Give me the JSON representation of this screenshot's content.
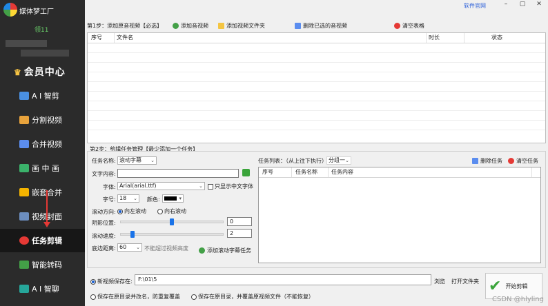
{
  "app": {
    "title": "媒体梦工厂",
    "user_code": "领11",
    "vip_label": "会员中心",
    "website_link": "软件官网",
    "window_controls": [
      "–",
      "▢",
      "✕"
    ]
  },
  "sidebar": {
    "items": [
      {
        "label": "A I 智剪",
        "icon": "ai-edit-icon",
        "color": "#4a90e2"
      },
      {
        "label": "分割视频",
        "icon": "split-video-icon",
        "color": "#e8a33c"
      },
      {
        "label": "合并视频",
        "icon": "merge-video-icon",
        "color": "#5b8def"
      },
      {
        "label": "画 中 画",
        "icon": "picture-in-picture-icon",
        "color": "#3bb26b"
      },
      {
        "label": "嵌套合并",
        "icon": "nested-merge-icon",
        "color": "#f4b400"
      },
      {
        "label": "视频封面",
        "icon": "video-cover-icon",
        "color": "#6c8ebf"
      },
      {
        "label": "任务剪辑",
        "icon": "task-edit-icon",
        "color": "#e53935"
      },
      {
        "label": "智能转码",
        "icon": "smart-transcode-icon",
        "color": "#43a047"
      },
      {
        "label": "A I 智聊",
        "icon": "ai-chat-icon",
        "color": "#26a69a"
      }
    ],
    "active_index": 6
  },
  "step1": {
    "title": "第1步：添加原音视频【必选】",
    "buttons": {
      "add_av": "添加音视频",
      "add_folder": "添加视频文件夹",
      "delete_selected": "删除已选的音视频",
      "clear_table": "清空表格"
    },
    "columns": [
      "序号",
      "文件名",
      "时长",
      "状态"
    ]
  },
  "step2": {
    "title": "第2步：剪辑任务管理【最少添加一个任务】",
    "task_name_label": "任务名称:",
    "task_name_value": "滚动字幕",
    "text_content_label": "文字内容:",
    "text_content_value": "",
    "font_label": "字体:",
    "font_value": "Arial(arial.ttf)",
    "cn_only_label": "只显示中文字体",
    "size_label": "字号:",
    "size_value": "18",
    "color_label": "颜色:",
    "color_value": "#000000",
    "direction_label": "滚动方向:",
    "direction_left": "向左滚动",
    "direction_right": "向右滚动",
    "shadow_label": "阴影位置:",
    "shadow_value": "0",
    "speed_label": "滚动速度:",
    "speed_value": "2",
    "bottom_label": "底边距离:",
    "bottom_value": "60",
    "bottom_note": "不能超过视频高度",
    "add_task_button": "添加滚动字幕任务",
    "task_list_label": "任务列表：（从上往下执行）",
    "group_value": "分组一",
    "delete_task": "删除任务",
    "clear_tasks": "清空任务",
    "task_columns": [
      "序号",
      "任务名称",
      "任务内容"
    ]
  },
  "output": {
    "save_label": "新视频保存在:",
    "path_value": "F:\\01\\5",
    "browse": "浏览",
    "open_folder": "打开文件夹",
    "option_rename": "保存在原目录并改名，防重复覆盖",
    "option_overwrite": "保存在原目录，并覆盖原视频文件（不能恢复）",
    "start_button": "开始剪辑"
  },
  "watermark": "CSDN @hlyling"
}
